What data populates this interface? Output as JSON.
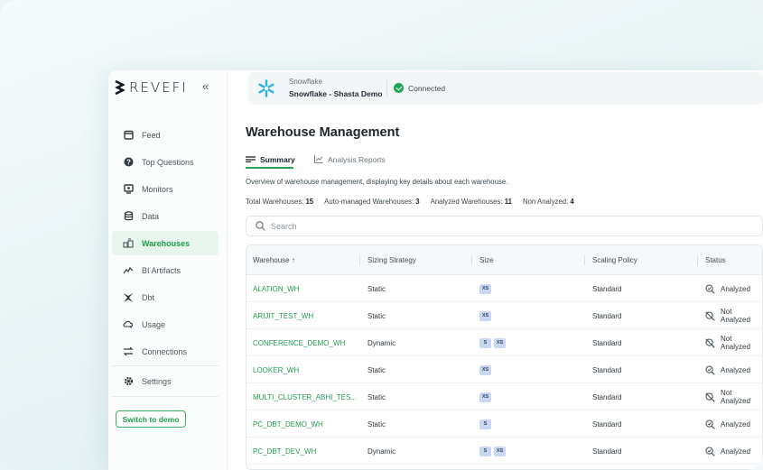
{
  "sidebar": {
    "logo_text": "REVEFI",
    "collapse_icon": "«",
    "items": [
      {
        "label": "Feed",
        "icon": "feed-icon"
      },
      {
        "label": "Top Questions",
        "icon": "question-icon"
      },
      {
        "label": "Monitors",
        "icon": "monitor-icon"
      },
      {
        "label": "Data",
        "icon": "database-icon"
      },
      {
        "label": "Warehouses",
        "icon": "warehouse-icon",
        "active": true
      },
      {
        "label": "BI Artifacts",
        "icon": "chart-line-icon"
      },
      {
        "label": "Dbt",
        "icon": "dbt-icon"
      },
      {
        "label": "Usage",
        "icon": "usage-icon"
      },
      {
        "label": "Connections",
        "icon": "connections-icon"
      },
      {
        "label": "Settings",
        "icon": "gear-icon"
      }
    ],
    "switch_demo_label": "Switch to demo"
  },
  "connection": {
    "type": "Snowflake",
    "name": "Snowflake - Shasta Demo",
    "status": "Connected"
  },
  "page": {
    "title": "Warehouse Management",
    "tabs": [
      {
        "label": "Summary",
        "active": true
      },
      {
        "label": "Analysis Reports",
        "active": false
      }
    ],
    "description": "Overview of warehouse management, displaying key details about each warehouse.",
    "stats": [
      {
        "label": "Total Warehouses:",
        "value": "15"
      },
      {
        "label": "Auto-managed Warehouses:",
        "value": "3"
      },
      {
        "label": "Analyzed Warehouses:",
        "value": "11"
      },
      {
        "label": "Non Analyzed:",
        "value": "4"
      }
    ],
    "search_placeholder": "Search"
  },
  "table": {
    "columns": [
      "Warehouse",
      "Sizing Strategy",
      "Size",
      "Scaling Policy",
      "Status"
    ],
    "sort_indicator": "↑",
    "rows": [
      {
        "warehouse": "ALATION_WH",
        "sizing": "Static",
        "sizes": [
          "XS"
        ],
        "policy": "Standard",
        "status": "Analyzed"
      },
      {
        "warehouse": "ARIJIT_TEST_WH",
        "sizing": "Static",
        "sizes": [
          "XS"
        ],
        "policy": "Standard",
        "status": "Not Analyzed"
      },
      {
        "warehouse": "CONFERENCE_DEMO_WH",
        "sizing": "Dynamic",
        "sizes": [
          "S",
          "XS"
        ],
        "policy": "Standard",
        "status": "Not Analyzed"
      },
      {
        "warehouse": "LOOKER_WH",
        "sizing": "Static",
        "sizes": [
          "XS"
        ],
        "policy": "Standard",
        "status": "Analyzed"
      },
      {
        "warehouse": "MULTI_CLUSTER_ABHI_TES...",
        "sizing": "Static",
        "sizes": [
          "XS"
        ],
        "policy": "Standard",
        "status": "Not Analyzed"
      },
      {
        "warehouse": "PC_DBT_DEMO_WH",
        "sizing": "Static",
        "sizes": [
          "S"
        ],
        "policy": "Standard",
        "status": "Analyzed"
      },
      {
        "warehouse": "PC_DBT_DEV_WH",
        "sizing": "Dynamic",
        "sizes": [
          "S",
          "XS"
        ],
        "policy": "Standard",
        "status": "Analyzed"
      }
    ]
  },
  "colors": {
    "accent": "#22a355",
    "active_bg": "#e8f5ec",
    "chip_bg": "#c9d8f0",
    "snowflake": "#29b5e8"
  }
}
